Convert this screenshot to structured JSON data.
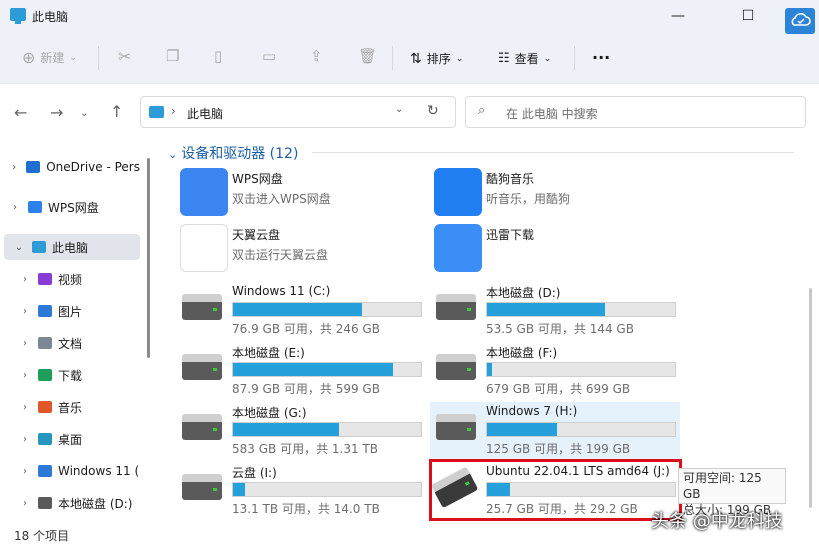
{
  "window": {
    "title": "此电脑"
  },
  "toolbar": {
    "new_label": "新建",
    "sort_label": "排序",
    "view_label": "查看",
    "more_label": "···"
  },
  "address": {
    "path": "此电脑",
    "search_placeholder": "在 此电脑 中搜索"
  },
  "sidebar": {
    "items": [
      {
        "label": "OneDrive - Pers",
        "indent": 0,
        "chevron": "›",
        "color": "#1f6fd1"
      },
      {
        "label": "WPS网盘",
        "indent": 0,
        "chevron": "›",
        "color": "#2f80ed"
      },
      {
        "label": "此电脑",
        "indent": 0,
        "chevron": "⌄",
        "color": "#2d9bd6",
        "selected": true
      },
      {
        "label": "视频",
        "indent": 1,
        "chevron": "›",
        "color": "#8a3bd1"
      },
      {
        "label": "图片",
        "indent": 1,
        "chevron": "›",
        "color": "#2b7bd6"
      },
      {
        "label": "文档",
        "indent": 1,
        "chevron": "›",
        "color": "#7b8794"
      },
      {
        "label": "下载",
        "indent": 1,
        "chevron": "›",
        "color": "#1e9e5a"
      },
      {
        "label": "音乐",
        "indent": 1,
        "chevron": "›",
        "color": "#e0572c"
      },
      {
        "label": "桌面",
        "indent": 1,
        "chevron": "›",
        "color": "#2596be"
      },
      {
        "label": "Windows 11 (",
        "indent": 1,
        "chevron": "›",
        "color": "#2b7bd6"
      },
      {
        "label": "本地磁盘 (D:)",
        "indent": 1,
        "chevron": "›",
        "color": "#5a5a5a"
      }
    ]
  },
  "group": {
    "header": "设备和驱动器 (12)"
  },
  "apps": [
    {
      "name": "WPS网盘",
      "sub": "双击进入WPS网盘",
      "icon": "wps-cloud-icon",
      "color": "#3b86f0"
    },
    {
      "name": "酷狗音乐",
      "sub": "听音乐，用酷狗",
      "icon": "kugou-icon",
      "color": "#1f7ff0"
    },
    {
      "name": "天翼云盘",
      "sub": "双击运行天翼云盘",
      "icon": "tianyi-cloud-icon",
      "color": "#ffffff"
    },
    {
      "name": "迅雷下载",
      "sub": "",
      "icon": "xunlei-icon",
      "color": "#3a8ef6"
    }
  ],
  "drives": [
    {
      "name": "Windows 11 (C:)",
      "sub": "76.9 GB 可用，共 246 GB",
      "used_fraction": 0.687
    },
    {
      "name": "本地磁盘 (D:)",
      "sub": "53.5 GB 可用，共 144 GB",
      "used_fraction": 0.628
    },
    {
      "name": "本地磁盘 (E:)",
      "sub": "87.9 GB 可用，共 599 GB",
      "used_fraction": 0.853
    },
    {
      "name": "本地磁盘 (F:)",
      "sub": "679 GB 可用，共 699 GB",
      "used_fraction": 0.029
    },
    {
      "name": "本地磁盘 (G:)",
      "sub": "583 GB 可用，共 1.31 TB",
      "used_fraction": 0.565
    },
    {
      "name": "Windows 7 (H:)",
      "sub": "125 GB 可用，共 199 GB",
      "used_fraction": 0.372
    },
    {
      "name": "云盘 (I:)",
      "sub": "13.1 TB 可用，共 14.0 TB",
      "used_fraction": 0.064
    },
    {
      "name": "Ubuntu 22.04.1 LTS amd64 (J:)",
      "sub": "25.7 GB 可用，共 29.2 GB",
      "used_fraction": 0.12
    }
  ],
  "tooltip": {
    "line1": "可用空间: 125 GB",
    "line2": "总大小: 199 GB"
  },
  "status": {
    "count": "18 个项目"
  },
  "watermark": {
    "text": "头条 @中龙科技"
  },
  "colors": {
    "accent": "#26a0da",
    "highlight_border": "#d9101c",
    "cloud_button": "#2b84d8"
  }
}
